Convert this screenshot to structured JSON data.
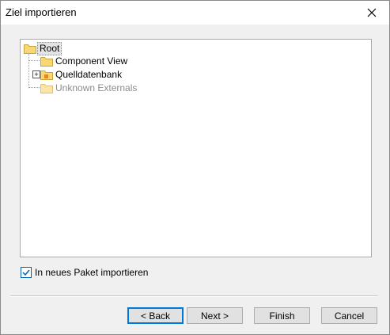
{
  "window": {
    "title": "Ziel importieren"
  },
  "tree": {
    "root": "Root",
    "children": [
      {
        "label": "Component View"
      },
      {
        "label": "Quelldatenbank",
        "expandable": true
      },
      {
        "label": "Unknown Externals",
        "disabled": true
      }
    ]
  },
  "options": {
    "import_new_package_label": "In neues Paket importieren",
    "import_new_package_checked": true
  },
  "buttons": {
    "back": "< Back",
    "next": "Next >",
    "finish": "Finish",
    "cancel": "Cancel"
  },
  "colors": {
    "accent": "#0078d7",
    "folder": "#f8d775",
    "disabled_text": "#8c8c8c"
  }
}
